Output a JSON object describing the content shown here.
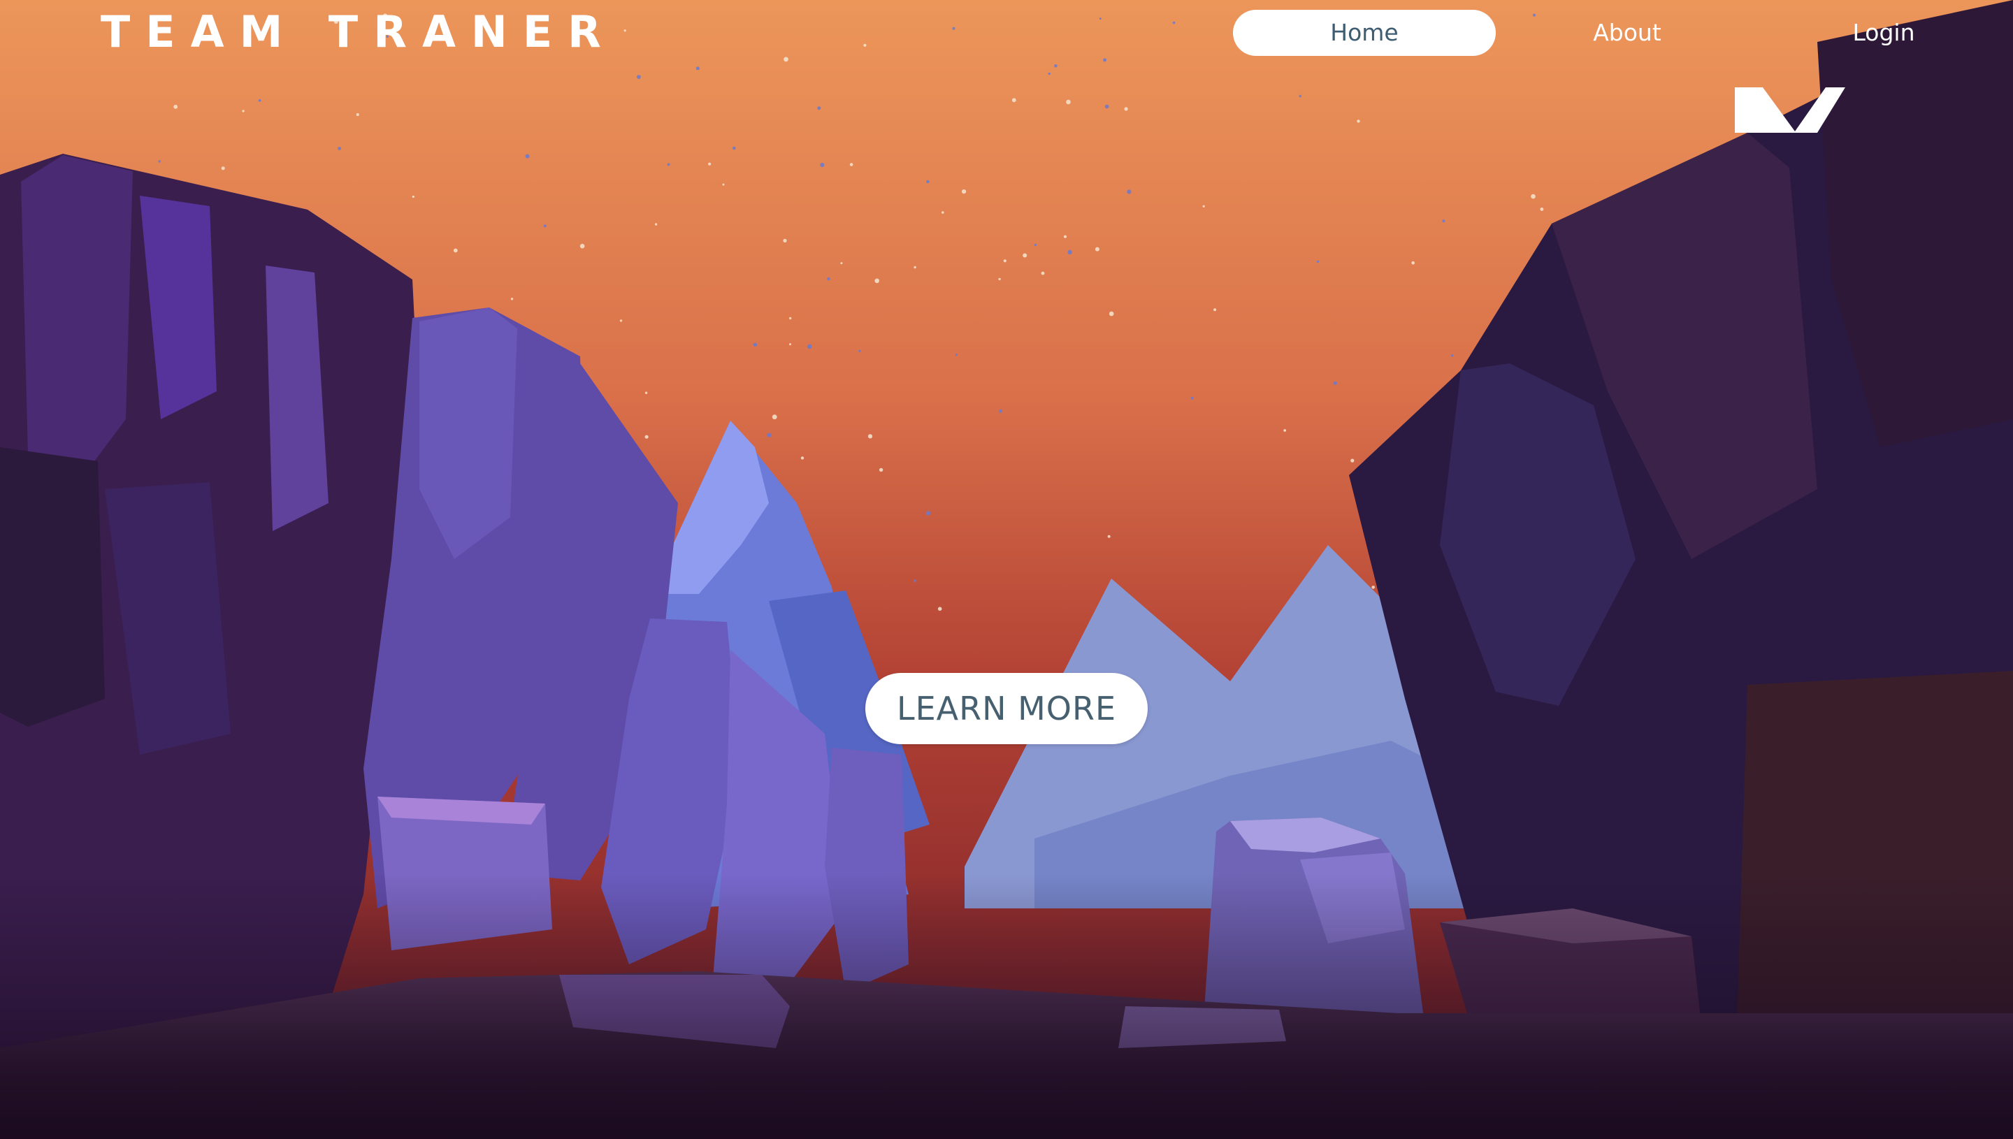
{
  "header": {
    "logo": "TEAM TRANER",
    "nav": [
      {
        "label": "Home",
        "active": true
      },
      {
        "label": "About",
        "active": false
      },
      {
        "label": "Login",
        "active": false
      }
    ]
  },
  "hero": {
    "cta_label": "LEARN MORE"
  },
  "colors": {
    "sky_top": "#e9905a",
    "sky_bottom": "#a83a2e",
    "rock_dark": "#2a1435",
    "rock_purple": "#4a2a78",
    "mountain_blue": "#7888d8",
    "ground": "#3b1d3d",
    "nav_active_text": "#3f5d72"
  }
}
